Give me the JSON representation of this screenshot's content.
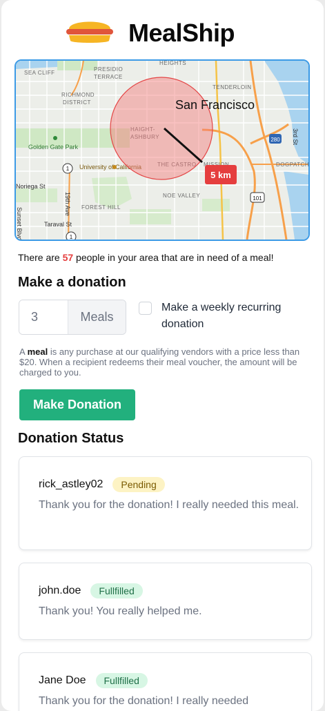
{
  "app": {
    "name": "MealShip"
  },
  "colors": {
    "accent": "#22b07d",
    "highlight": "#e53e3e",
    "map_border": "#3b9ae6"
  },
  "map": {
    "city_label": "San Francisco",
    "radius_label": "5 km",
    "place_labels": {
      "sea_cliff": "SEA CLIFF",
      "presidio_terrace_1": "PRESIDIO",
      "presidio_terrace_2": "TERRACE",
      "heights": "HEIGHTS",
      "tenderloin": "TENDERLOIN",
      "richmond_1": "RICHMOND",
      "richmond_2": "DISTRICT",
      "haight_1": "HAIGHT-",
      "haight_2": "ASHBURY",
      "golden_gate_park": "Golden Gate Park",
      "university": "University of California",
      "castro": "THE CASTRO",
      "mission": "MISSION",
      "dogpatch": "DOGPATCH",
      "noriega": "Noriega St",
      "nineteenth": "19th Ave",
      "forest_hill": "FOREST HILL",
      "noe_valley": "NOE VALLEY",
      "taraval": "Taraval St",
      "sunset": "Sunset Blvd",
      "third_st": "3rd St",
      "highway_280": "280",
      "highway_101": "101",
      "route_1a": "1",
      "route_1b": "1"
    }
  },
  "need": {
    "prefix": "There are ",
    "count": "57",
    "suffix": " people in your area that are in need of a meal!"
  },
  "donation": {
    "heading": "Make a donation",
    "meals_value": "3",
    "meals_unit": "Meals",
    "recurring_label": "Make a weekly recurring donation",
    "note_prefix": "A ",
    "note_bold": "meal",
    "note_suffix": " is any purchase at our qualifying vendors with a price less than $20. When a recipient redeems their meal voucher, the amount will be charged to you.",
    "button_label": "Make Donation"
  },
  "status": {
    "heading": "Donation Status",
    "items": [
      {
        "user": "rick_astley02",
        "badge": "Pending",
        "message": "Thank you for the donation! I really needed this meal."
      },
      {
        "user": "john.doe",
        "badge": "Fullfilled",
        "message": "Thank you! You really helped me."
      },
      {
        "user": "Jane Doe",
        "badge": "Fullfilled",
        "message": "Thank you for the donation! I really needed"
      }
    ]
  }
}
